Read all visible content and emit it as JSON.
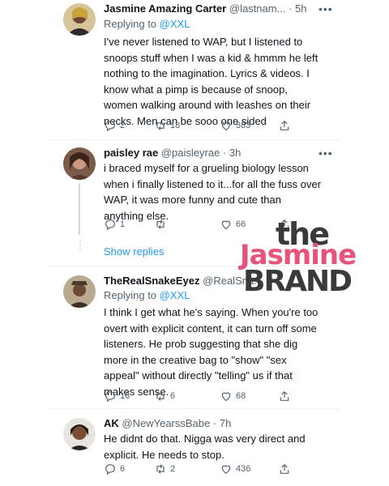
{
  "tweets": [
    {
      "name": "Jasmine Amazing Carter",
      "handle": "@lastnam...",
      "time": "5h",
      "replying_label": "Replying to ",
      "replying_to": "@XXL",
      "text": "I've never listened to WAP, but I listened to snoops stuff when I was a kid & hmmm he left nothing to the imagination. Lyrics & videos. I know what a pimp is because of snoop, women walking around with leashes on their necks. Men can be sooo one sided",
      "replies": "2",
      "retweets": "18",
      "likes": "383"
    },
    {
      "name": "paisley rae",
      "handle": "@paisleyrae",
      "time": "3h",
      "text": "i braced myself for a grueling biology lesson when i finally listened to it...for all the fuss over WAP, it was more funny and cute than anything else.",
      "replies": "1",
      "retweets": "",
      "likes": "66"
    },
    {
      "name": "TheRealSnakeEyez",
      "handle": "@RealSna...",
      "time": "",
      "replying_label": "Replying to ",
      "replying_to": "@XXL",
      "text": "I think I get what he's saying. When you're too overt with explicit content, it can turn off some listeners. He prob suggesting that she dig more in the creative bag to \"show\" \"sex appeal\" without directly \"telling\" us if that makes sense.",
      "replies": "16",
      "retweets": "6",
      "likes": "68"
    },
    {
      "name": "AK",
      "handle": "@NewYearssBabe",
      "time": "7h",
      "text": "He didnt do that. Nigga was very direct and explicit. He needs to stop.",
      "replies": "6",
      "retweets": "2",
      "likes": "436"
    }
  ],
  "show_replies": "Show replies",
  "watermark": {
    "line1": "the",
    "line2": "Jasmine",
    "line3": "BRAND"
  },
  "icons": [
    "reply-icon",
    "retweet-icon",
    "like-icon",
    "share-icon",
    "more-icon"
  ],
  "colors": {
    "accent": "#1d9bf0",
    "muted": "#536471",
    "watermark_pink": "#e8537a"
  }
}
